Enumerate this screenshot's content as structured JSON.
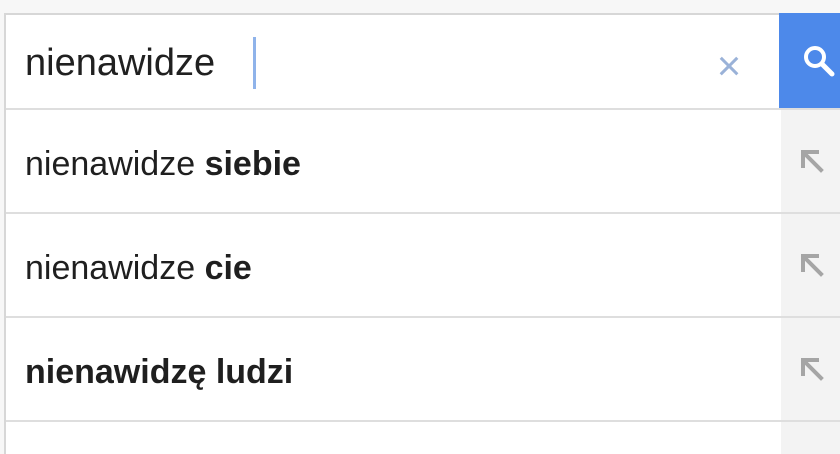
{
  "search": {
    "query": "nienawidze",
    "clear_icon": "×",
    "search_icon": "search-icon"
  },
  "suggestions": [
    {
      "prefix": "nienawidze ",
      "bold": "siebie",
      "action_icon": "arrow-up-left-icon"
    },
    {
      "prefix": "nienawidze ",
      "bold": "cie",
      "action_icon": "arrow-up-left-icon"
    },
    {
      "prefix": "",
      "bold": "nienawidzę ludzi",
      "action_icon": "arrow-up-left-icon"
    }
  ],
  "colors": {
    "search_button": "#4d89ea",
    "caret": "#8fb3ea",
    "clear_icon": "#9ab2d8",
    "arrow_icon": "#a5a5a5"
  }
}
